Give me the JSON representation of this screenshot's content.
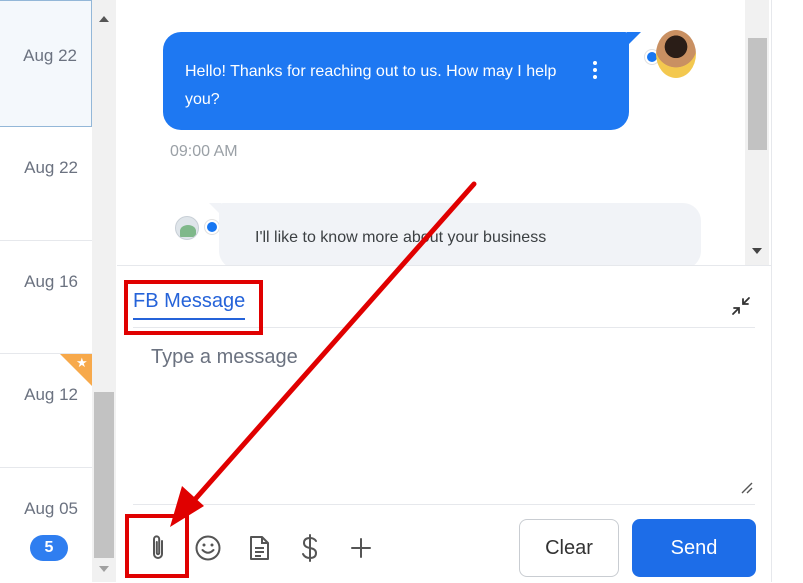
{
  "conversations": [
    {
      "date": "Aug 22"
    },
    {
      "date": "Aug 22"
    },
    {
      "date": "Aug 16"
    },
    {
      "date": "Aug 12"
    },
    {
      "date": "Aug 05",
      "unread": "5"
    }
  ],
  "chat": {
    "outgoing_message": "Hello! Thanks for reaching out to us. How may I help you?",
    "outgoing_time": "09:00 AM",
    "incoming_message": "I'll like to know more about your business"
  },
  "composer": {
    "channel_tab": "FB Message",
    "placeholder": "Type a message",
    "clear_label": "Clear",
    "send_label": "Send"
  },
  "toolbar_icons": [
    "paperclip-icon",
    "emoji-icon",
    "document-icon",
    "dollar-icon",
    "plus-icon"
  ],
  "colors": {
    "accent": "#1d6de8",
    "outgoing_bubble": "#1e78f2",
    "incoming_bubble": "#f1f3f7",
    "badge": "#2f7ef0",
    "star_corner": "#f7a94b",
    "annotation": "#e00000"
  }
}
